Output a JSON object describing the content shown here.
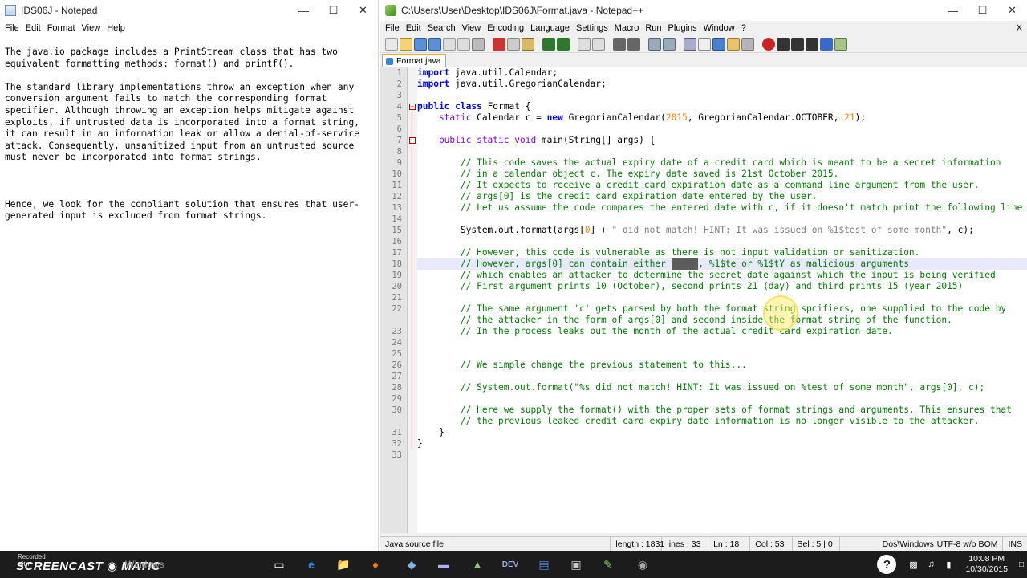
{
  "notepad": {
    "title": "IDS06J - Notepad",
    "menu": [
      "File",
      "Edit",
      "Format",
      "View",
      "Help"
    ],
    "paragraphs": [
      "The java.io package includes a PrintStream class that has two\nequivalent formatting methods: format() and printf().",
      "The standard library implementations throw an exception when any\nconversion argument fails to match the corresponding format\nspecifier. Although throwing an exception helps mitigate against\nexploits, if untrusted data is incorporated into a format string,\nit can result in an information leak or allow a denial-of-service\nattack. Consequently, unsanitized input from an untrusted source\nmust never be incorporated into format strings.",
      "\n\n\nHence, we look for the compliant solution that ensures that user-\ngenerated input is excluded from format strings."
    ]
  },
  "npp": {
    "title": "C:\\Users\\User\\Desktop\\IDS06J\\Format.java - Notepad++",
    "menu": [
      "File",
      "Edit",
      "Search",
      "View",
      "Encoding",
      "Language",
      "Settings",
      "Macro",
      "Run",
      "Plugins",
      "Window",
      "?"
    ],
    "close_doc": "X",
    "tab": "Format.java",
    "line_numbers": [
      "1",
      "2",
      "3",
      "4",
      "5",
      "6",
      "7",
      "8",
      "9",
      "10",
      "11",
      "12",
      "13",
      "14",
      "15",
      "16",
      "17",
      "18",
      "19",
      "20",
      "21",
      "22",
      "",
      "23",
      "24",
      "25",
      "26",
      "27",
      "28",
      "29",
      "30",
      "",
      "31",
      "32",
      "33"
    ],
    "status": {
      "file_type": "Java source file",
      "length": "length : 1831",
      "lines": "lines : 33",
      "ln": "Ln : 18",
      "col": "Col : 53",
      "sel": "Sel : 5 | 0",
      "eol": "Dos\\Windows",
      "encoding": "UTF-8 w/o BOM",
      "mode": "INS"
    }
  },
  "code": {
    "l1_kw": "import",
    "l1_rest": " java.util.Calendar;",
    "l2_kw": "import",
    "l2_rest": " java.util.GregorianCalendar;",
    "l4_kw": "public class",
    "l4_rest": " Format {",
    "l5_a": "    static",
    "l5_b": " Calendar c = ",
    "l5_c": "new",
    "l5_d": " GregorianCalendar(",
    "l5_e": "2015",
    "l5_f": ", GregorianCalendar.OCTOBER, ",
    "l5_g": "21",
    "l5_h": ");",
    "l7_a": "    public static void",
    "l7_b": " main(String[] args) {",
    "l9": "        // This code saves the actual expiry date of a credit card which is meant to be a secret information",
    "l10": "        // in a calendar object c. The expiry date saved is 21st October 2015.",
    "l11": "        // It expects to receive a credit card expiration date as a command line argument from the user.",
    "l12": "        // args[0] is the credit card expiration date entered by the user.",
    "l13": "        // Let us assume the code compares the entered date with c, if it doesn't match print the following line",
    "l15_a": "        System.out.format(args[",
    "l15_b": "0",
    "l15_c": "] + ",
    "l15_d": "\" did not match! HINT: It was issued on %1$test of some month\"",
    "l15_e": ", c);",
    "l17": "        // However, this code is vulnerable as there is not input validation or sanitization.",
    "l18_a": "        // However, args[0] can contain either ",
    "l18_sel": "%1$tm",
    "l18_b": ", %1$te or %1$tY as malicious arguments",
    "l19": "        // which enables an attacker to determine the secret date against which the input is being verified",
    "l20": "        // First argument prints 10 (October), second prints 21 (day) and third prints 15 (year 2015)",
    "l22a": "        // The same argument 'c' gets parsed by both the format string spcifiers, one supplied to the code by",
    "l22b": "        // the attacker in the form of args[0] and second inside the format string of the function.",
    "l23": "        // In the process leaks out the month of the actual credit card expiration date.",
    "l26": "        // We simple change the previous statement to this...",
    "l28": "        // System.out.format(\"%s did not match! HINT: It was issued on %test of some month\", args[0], c);",
    "l30a": "        // Here we supply the format() with the proper sets of format strings and arguments. This ensures that",
    "l30b": "        // the previous leaked credit card expiry date information is no longer visible to the attacker.",
    "l31": "    }",
    "l32": "}"
  },
  "taskbar": {
    "recorded": "Recorded with",
    "brand": "SCREENCAST ◉ MATIC",
    "windows": "Windows",
    "time": "10:08 PM",
    "date": "10/30/2015"
  }
}
